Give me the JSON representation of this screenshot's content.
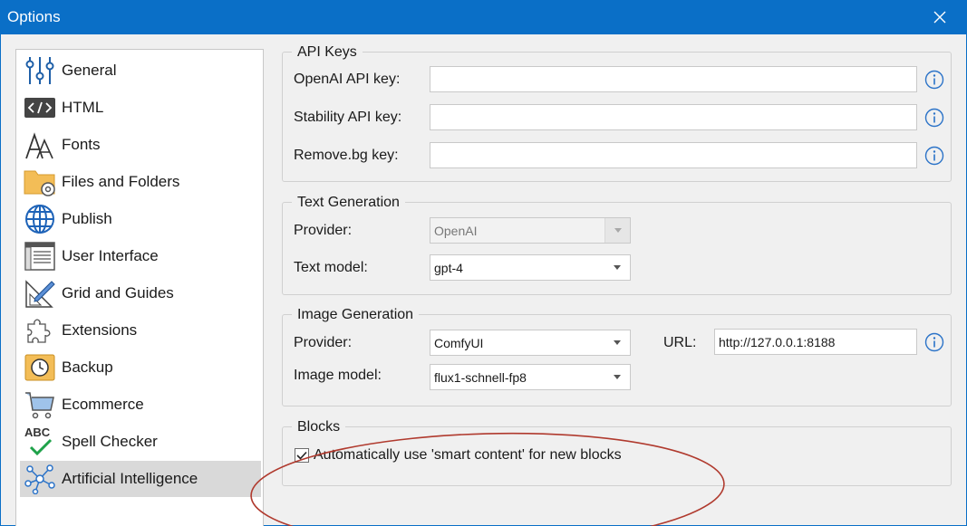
{
  "window": {
    "title": "Options",
    "accent_color": "#0a6fc7",
    "close_icon": "close-icon"
  },
  "sidebar": {
    "items": [
      {
        "label": "General",
        "icon": "sliders-icon"
      },
      {
        "label": "HTML",
        "icon": "code-icon"
      },
      {
        "label": "Fonts",
        "icon": "fonts-icon"
      },
      {
        "label": "Files and Folders",
        "icon": "folder-gear-icon"
      },
      {
        "label": "Publish",
        "icon": "globe-icon"
      },
      {
        "label": "User Interface",
        "icon": "window-icon"
      },
      {
        "label": "Grid and Guides",
        "icon": "ruler-pencil-icon"
      },
      {
        "label": "Extensions",
        "icon": "puzzle-icon"
      },
      {
        "label": "Backup",
        "icon": "backup-clock-icon"
      },
      {
        "label": "Ecommerce",
        "icon": "cart-icon"
      },
      {
        "label": "Spell Checker",
        "icon": "spellcheck-icon",
        "icon_text": "ABC"
      },
      {
        "label": "Artificial Intelligence",
        "icon": "network-nodes-icon",
        "selected": true
      }
    ]
  },
  "api_keys": {
    "legend": "API Keys",
    "openai_label": "OpenAI API key:",
    "openai_value": "",
    "stability_label": "Stability API key:",
    "stability_value": "",
    "removebg_label": "Remove.bg key:",
    "removebg_value": ""
  },
  "text_generation": {
    "legend": "Text Generation",
    "provider_label": "Provider:",
    "provider_value": "OpenAI",
    "provider_disabled": true,
    "model_label": "Text model:",
    "model_value": "gpt-4"
  },
  "image_generation": {
    "legend": "Image Generation",
    "provider_label": "Provider:",
    "provider_value": "ComfyUI",
    "url_label": "URL:",
    "url_value": "http://127.0.0.1:8188",
    "model_label": "Image model:",
    "model_value": "flux1-schnell-fp8"
  },
  "blocks": {
    "legend": "Blocks",
    "smart_content_label": "Automatically use 'smart content' for new blocks",
    "smart_content_checked": true,
    "annotation_color": "#b03a2e"
  }
}
